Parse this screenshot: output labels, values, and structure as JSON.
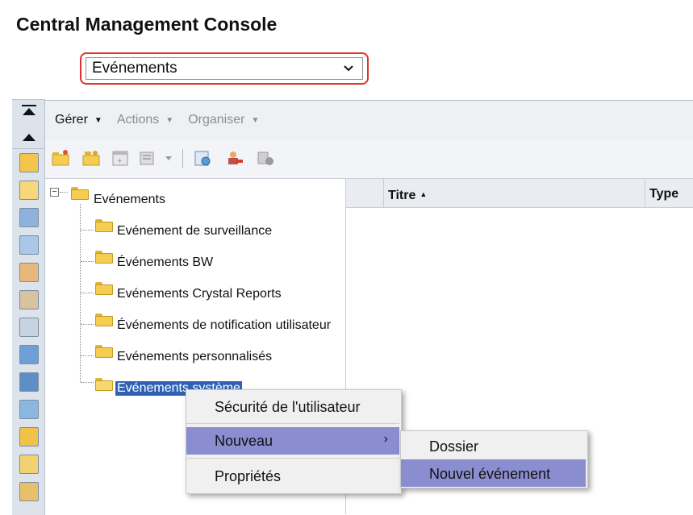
{
  "app": {
    "title": "Central Management Console"
  },
  "view_select": {
    "value": "Evénements"
  },
  "menubar": {
    "items": [
      {
        "label": "Gérer",
        "enabled": true
      },
      {
        "label": "Actions",
        "enabled": false
      },
      {
        "label": "Organiser",
        "enabled": false
      }
    ]
  },
  "tree": {
    "root": "Evénements",
    "children": [
      "Evénement de surveillance",
      "Événements BW",
      "Evénements Crystal Reports",
      "Événements de notification utilisateur",
      "Evénements personnalisés",
      "Evénements système"
    ],
    "selected": "Evénements système"
  },
  "list": {
    "columns": [
      "Titre",
      "Type"
    ],
    "sort_indicator": "▲"
  },
  "context_menu": {
    "items": [
      "Sécurité de l'utilisateur",
      "Nouveau",
      "Propriétés"
    ],
    "active": "Nouveau",
    "submenu_arrow": "›"
  },
  "submenu": {
    "items": [
      "Dossier",
      "Nouvel événement"
    ],
    "active": "Nouvel événement"
  },
  "colors": {
    "highlight": "#8a8dd0",
    "selection": "#2f62b4",
    "focus_border": "#e0322f"
  }
}
